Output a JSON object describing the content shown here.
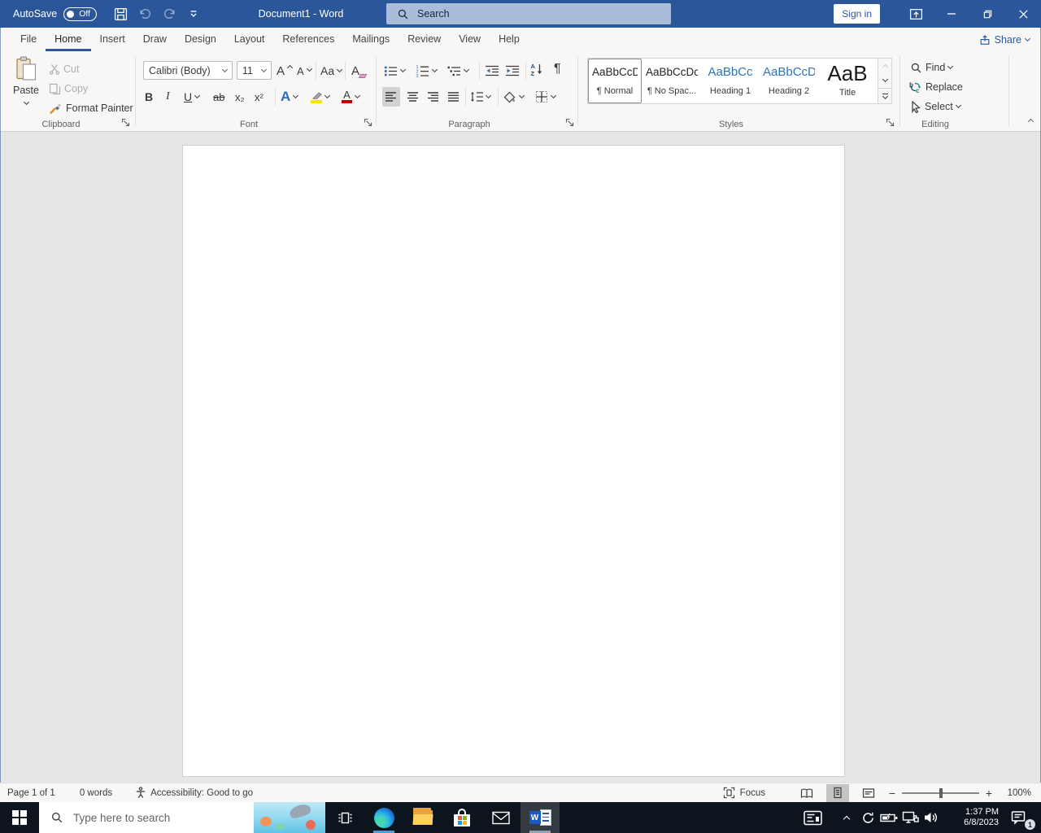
{
  "colors": {
    "accent_blue": "#2b579a",
    "heading_blue": "#2e74b5",
    "highlight_yellow": "#ffe81a",
    "font_color_red": "#c00000",
    "taskbar_dark": "#0c151e",
    "document_bg": "#e7e6e6",
    "edge_indicator": "#4f9bd8"
  },
  "titlebar": {
    "autosave_label": "AutoSave",
    "autosave_state": "Off",
    "title": "Document1 - Word",
    "search_placeholder": "Search",
    "sign_in": "Sign in"
  },
  "tabs": {
    "items": [
      {
        "label": "File"
      },
      {
        "label": "Home"
      },
      {
        "label": "Insert"
      },
      {
        "label": "Draw"
      },
      {
        "label": "Design"
      },
      {
        "label": "Layout"
      },
      {
        "label": "References"
      },
      {
        "label": "Mailings"
      },
      {
        "label": "Review"
      },
      {
        "label": "View"
      },
      {
        "label": "Help"
      }
    ],
    "active_tab": "Home",
    "share": "Share"
  },
  "ribbon": {
    "clipboard": {
      "label": "Clipboard",
      "paste": "Paste",
      "cut": "Cut",
      "copy": "Copy",
      "format_painter": "Format Painter"
    },
    "font": {
      "label": "Font",
      "family": "Calibri (Body)",
      "size": "11",
      "grow": "A",
      "shrink": "A",
      "change_case": "Aa",
      "clear": "A",
      "bold": "B",
      "italic": "I",
      "underline": "U",
      "strike": "ab",
      "sub": "x₂",
      "sup": "x²",
      "effects": "A",
      "color": "A"
    },
    "paragraph": {
      "label": "Paragraph",
      "pilcrow": "¶",
      "sort_a": "A",
      "sort_z": "Z",
      "num": [
        "1",
        "2",
        "3"
      ]
    },
    "styles": {
      "label": "Styles",
      "items": [
        {
          "preview": "AaBbCcDc",
          "name": "¶ Normal",
          "selected": true
        },
        {
          "preview": "AaBbCcDc",
          "name": "¶ No Spac..."
        },
        {
          "preview": "AaBbCc",
          "name": "Heading 1"
        },
        {
          "preview": "AaBbCcD",
          "name": "Heading 2"
        },
        {
          "preview": "AaB",
          "name": "Title"
        }
      ]
    },
    "editing": {
      "label": "Editing",
      "find": "Find",
      "replace": "Replace",
      "select": "Select",
      "replace_b": "b",
      "replace_c": "c"
    }
  },
  "statusbar": {
    "page": "Page 1 of 1",
    "words": "0 words",
    "accessibility": "Accessibility: Good to go",
    "focus": "Focus",
    "zoom": "100%"
  },
  "taskbar": {
    "search_placeholder": "Type here to search",
    "word_icon_letter": "W",
    "clock": {
      "time": "1:37 PM",
      "date": "6/8/2023"
    },
    "badge": "1"
  }
}
